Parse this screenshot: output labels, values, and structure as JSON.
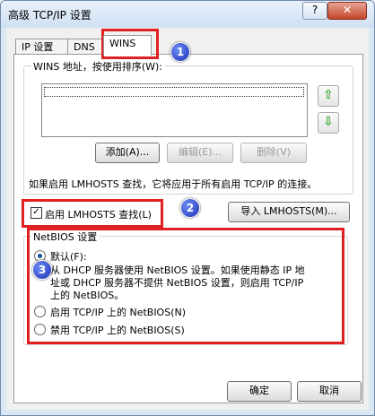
{
  "window": {
    "title": "高级 TCP/IP 设置",
    "help_label": "?",
    "close_label": "✕"
  },
  "tabs": [
    {
      "label": "IP 设置"
    },
    {
      "label": "DNS"
    },
    {
      "label": "WINS"
    }
  ],
  "wins": {
    "group_label": "WINS 地址，按使用排序(W):",
    "up_icon": "up-arrow-icon",
    "down_icon": "down-arrow-icon",
    "add_label": "添加(A)...",
    "edit_label": "编辑(E)...",
    "delete_label": "删除(V)"
  },
  "lmhosts": {
    "info_text": "如果启用 LMHOSTS 查找，它将应用于所有启用 TCP/IP 的连接。",
    "checkbox_label": "启用 LMHOSTS 查找(L)",
    "checked": true,
    "import_label": "导入 LMHOSTS(M)..."
  },
  "netbios": {
    "group_label": "NetBIOS 设置",
    "default_label": "默认(F):",
    "default_desc_line1": "从 DHCP 服务器使用 NetBIOS 设置。如果使用静态 IP 地",
    "default_desc_line2": "址或 DHCP 服务器不提供 NetBIOS 设置，则启用 TCP/IP",
    "default_desc_line3": "上的 NetBIOS。",
    "enable_label": "启用 TCP/IP 上的 NetBIOS(N)",
    "disable_label": "禁用 TCP/IP 上的 NetBIOS(S)",
    "selected": "default"
  },
  "footer": {
    "ok_label": "确定",
    "cancel_label": "取消"
  },
  "annotations": {
    "badge1": "1",
    "badge2": "2",
    "badge3": "3"
  },
  "colors": {
    "highlight": "#e02020",
    "badge": "#2a44d0"
  }
}
